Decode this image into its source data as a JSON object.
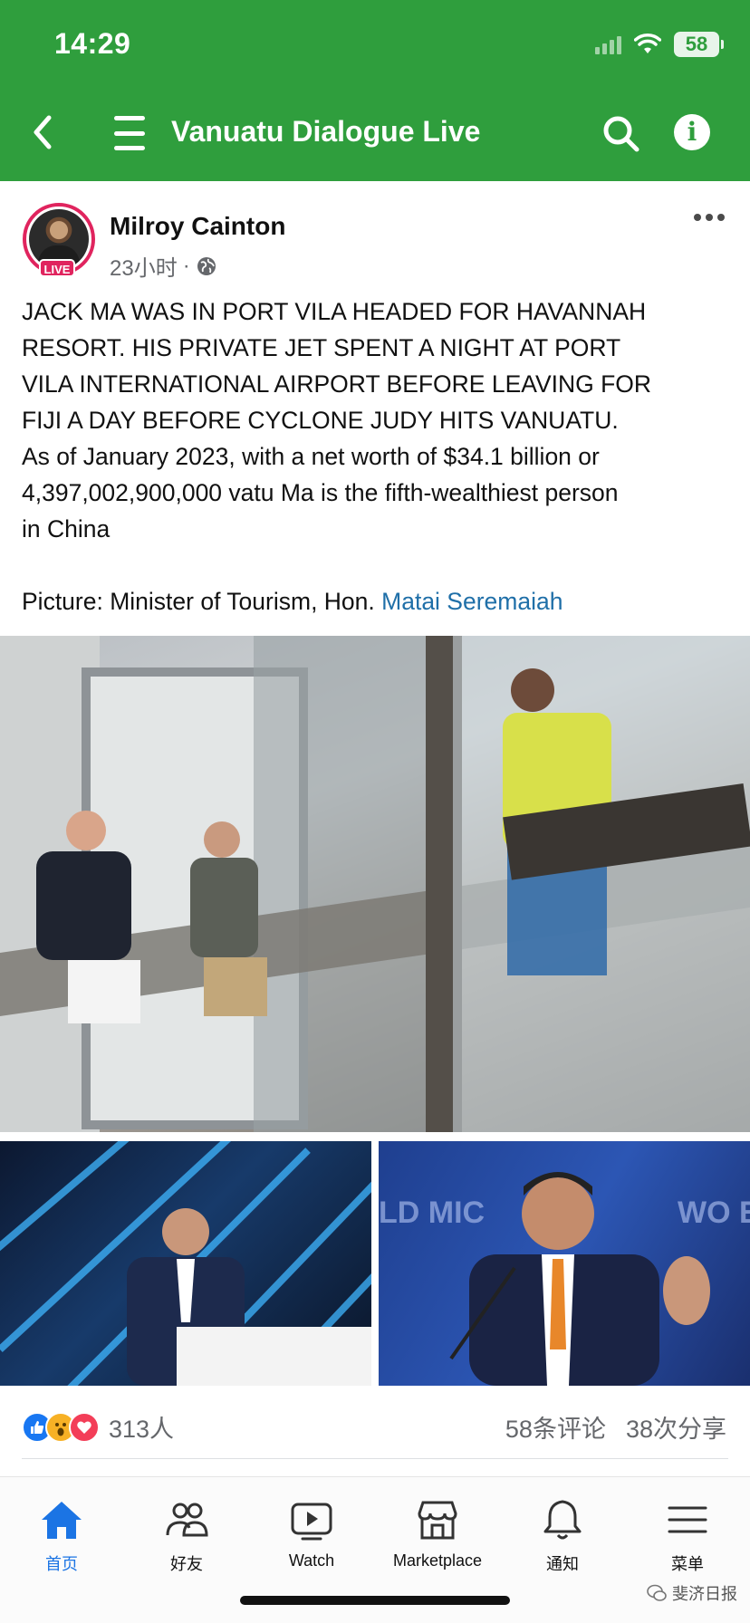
{
  "status_bar": {
    "time": "14:29",
    "battery": "58"
  },
  "header": {
    "title": "Vanuatu Dialogue Live"
  },
  "post": {
    "author": "Milroy Cainton",
    "live_badge": "LIVE",
    "time": "23小时",
    "separator": "·",
    "text_lines": [
      "JACK MA WAS IN PORT VILA HEADED FOR HAVANNAH",
      "RESORT. HIS PRIVATE JET SPENT A NIGHT AT PORT",
      "VILA INTERNATIONAL AIRPORT BEFORE LEAVING FOR",
      "FIJI A DAY BEFORE CYCLONE JUDY HITS VANUATU.",
      "As of January 2023, with a net worth of $34.1 billion or",
      "4,397,002,900,000 vatu Ma is the fifth-wealthiest person",
      "in China"
    ],
    "picture_prefix": "Picture: Minister of Tourism, Hon. ",
    "picture_link": "Matai Seremaiah",
    "reaction_count": "313人",
    "comments": "58条评论",
    "shares": "38次分享"
  },
  "tabs": [
    {
      "label": "首页",
      "icon": "home-icon"
    },
    {
      "label": "好友",
      "icon": "friends-icon"
    },
    {
      "label": "Watch",
      "icon": "watch-icon"
    },
    {
      "label": "Marketplace",
      "icon": "marketplace-icon"
    },
    {
      "label": "通知",
      "icon": "bell-icon"
    },
    {
      "label": "菜单",
      "icon": "menu-icon"
    }
  ],
  "watermark": "斐济日报",
  "colors": {
    "header_green": "#2f9e3d",
    "link_blue": "#1f6fa8",
    "tab_active": "#1b74e4",
    "live_red": "#e0245e"
  }
}
